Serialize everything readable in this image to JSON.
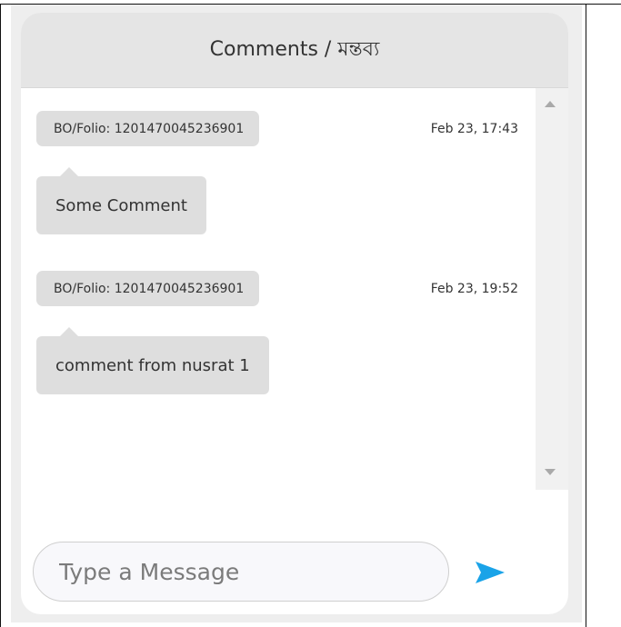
{
  "header": {
    "title": "Comments / মন্তব্য"
  },
  "messages": [
    {
      "user": "BO/Folio: 1201470045236901",
      "time": "Feb 23, 17:43",
      "text": "Some Comment"
    },
    {
      "user": "BO/Folio: 1201470045236901",
      "time": "Feb 23, 19:52",
      "text": "comment from nusrat 1"
    }
  ],
  "composer": {
    "placeholder": "Type a Message",
    "value": ""
  },
  "icons": {
    "send": "send-icon",
    "scroll_up": "scroll-up-icon",
    "scroll_down": "scroll-down-icon"
  },
  "colors": {
    "accent": "#1aa3e8",
    "bubble": "#dedede",
    "header": "#e5e5e5"
  }
}
